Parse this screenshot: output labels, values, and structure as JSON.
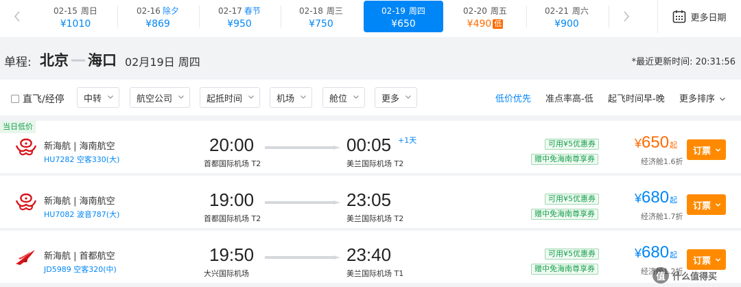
{
  "date_strip": {
    "tabs": [
      {
        "date": "02-15",
        "day": "周日",
        "holiday": "",
        "price": "¥1010",
        "low": "",
        "active": false,
        "orange": false
      },
      {
        "date": "02-16",
        "day": "",
        "holiday": "除夕",
        "price": "¥869",
        "low": "",
        "active": false,
        "orange": false
      },
      {
        "date": "02-17",
        "day": "",
        "holiday": "春节",
        "price": "¥950",
        "low": "",
        "active": false,
        "orange": false
      },
      {
        "date": "02-18",
        "day": "周三",
        "holiday": "",
        "price": "¥750",
        "low": "",
        "active": false,
        "orange": false
      },
      {
        "date": "02-19",
        "day": "周四",
        "holiday": "",
        "price": "¥650",
        "low": "",
        "active": true,
        "orange": false
      },
      {
        "date": "02-20",
        "day": "周五",
        "holiday": "",
        "price": "¥490",
        "low": "低",
        "active": false,
        "orange": true
      },
      {
        "date": "02-21",
        "day": "周六",
        "holiday": "",
        "price": "¥900",
        "low": "",
        "active": false,
        "orange": false
      }
    ],
    "prev_icon": "chevron-left-icon",
    "next_icon": "chevron-right-icon",
    "more_dates_label": "更多日期",
    "calendar_icon": "calendar-icon"
  },
  "route": {
    "trip_type": "单程:",
    "from_city": "北京",
    "to_city": "海口",
    "date_text": "02月19日 周四",
    "update_text": "*最近更新时间: 20:31:56"
  },
  "filters": {
    "direct_label": "直飞/经停",
    "selects": [
      "中转",
      "航空公司",
      "起抵时间",
      "机场",
      "舱位",
      "更多"
    ],
    "sorts": [
      {
        "label": "低价优先",
        "active": true,
        "caret": false
      },
      {
        "label": "准点率高-低",
        "active": false,
        "caret": false
      },
      {
        "label": "起飞时间早-晚",
        "active": false,
        "caret": false
      },
      {
        "label": "更多排序",
        "active": false,
        "caret": true
      }
    ]
  },
  "flights": [
    {
      "badge": "当日低价",
      "airline": "新海航 | 海南航空",
      "flight_no": "HU7282 空客330(大)",
      "dep_time": "20:00",
      "dep_airport": "首都国际机场 T2",
      "arr_time": "00:05",
      "arr_airport": "美兰国际机场 T2",
      "plus_day": "+1天",
      "tag1": "可用¥5优惠券",
      "tag2": "赠中免海南尊享券",
      "price_num": "650",
      "price_unit": "起",
      "cabin": "经济舱1.6折",
      "book_label": "订票",
      "logo": "hainan-airlines-logo",
      "price_color": "#ff6b00"
    },
    {
      "badge": "",
      "airline": "新海航 | 海南航空",
      "flight_no": "HU7082 波音787(大)",
      "dep_time": "19:00",
      "dep_airport": "首都国际机场 T2",
      "arr_time": "23:05",
      "arr_airport": "美兰国际机场 T2",
      "plus_day": "",
      "tag1": "可用¥5优惠券",
      "tag2": "赠中免海南尊享券",
      "price_num": "680",
      "price_unit": "起",
      "cabin": "经济舱1.7折",
      "book_label": "订票",
      "logo": "hainan-airlines-logo",
      "price_color": "#0086f6"
    },
    {
      "badge": "",
      "airline": "新海航 | 首都航空",
      "flight_no": "JD5989 空客320(中)",
      "dep_time": "19:50",
      "dep_airport": "大兴国际机场",
      "arr_time": "23:40",
      "arr_airport": "美兰国际机场 T1",
      "plus_day": "",
      "tag1": "可用¥5优惠券",
      "tag2": "赠中免海南尊享券",
      "price_num": "680",
      "price_unit": "起",
      "cabin": "经济舱1.2折",
      "book_label": "订票",
      "logo": "capital-airlines-logo",
      "price_color": "#0086f6"
    }
  ],
  "currency_symbol": "¥",
  "watermark": {
    "logo_char": "值",
    "text": "什么值得买"
  }
}
